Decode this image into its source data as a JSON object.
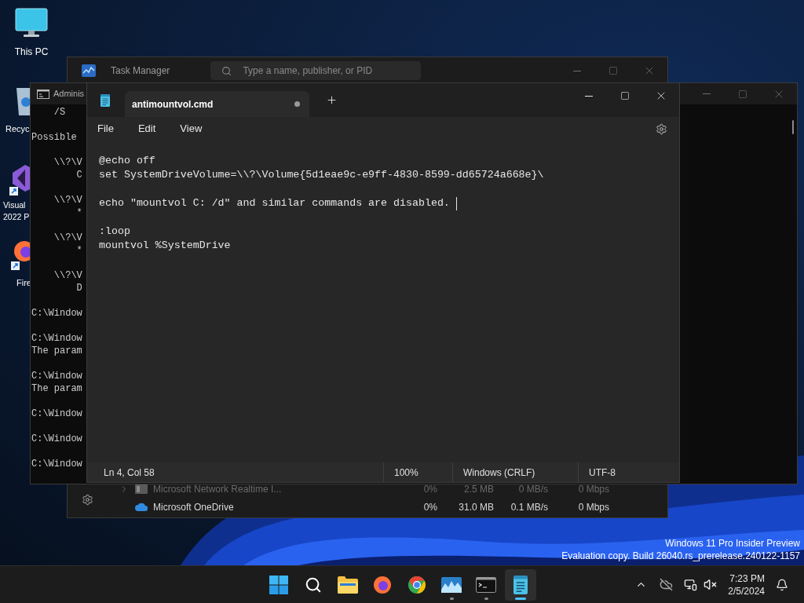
{
  "desktop": {
    "icons": [
      {
        "kind": "pc",
        "label_lines": [
          "This PC"
        ]
      },
      {
        "kind": "recycle",
        "label_lines": [
          "Recyc"
        ]
      },
      {
        "kind": "visual-studio",
        "label_lines": [
          "Visual",
          "2022 P"
        ]
      },
      {
        "kind": "firefox",
        "label_lines": [
          "Fire"
        ]
      }
    ]
  },
  "task_manager": {
    "title": "Task Manager",
    "search": {
      "placeholder": "Type a name, publisher, or PID"
    },
    "rows": [
      {
        "name": "Microsoft Network Realtime I...",
        "expandable": true,
        "dimmed": true,
        "values": [
          "0%",
          "2.5 MB",
          "0 MB/s",
          "0 Mbps"
        ]
      },
      {
        "name": "Microsoft OneDrive",
        "expandable": false,
        "dimmed": false,
        "values": [
          "0%",
          "31.0 MB",
          "0.1 MB/s",
          "0 Mbps"
        ]
      }
    ]
  },
  "console": {
    "title": "Adminis",
    "blocks": [
      [
        "    /S"
      ],
      [
        "Possible"
      ],
      [
        "    \\\\?\\V",
        "        C"
      ],
      [
        "    \\\\?\\V",
        "        *"
      ],
      [
        "    \\\\?\\V",
        "        *"
      ],
      [
        "    \\\\?\\V",
        "        D"
      ],
      [
        "C:\\Window"
      ],
      [
        "C:\\Window",
        "The param"
      ],
      [
        "C:\\Window",
        "The param"
      ],
      [
        "C:\\Window"
      ],
      [
        "C:\\Window"
      ],
      [
        "C:\\Window"
      ]
    ]
  },
  "notepad": {
    "tabs": [
      {
        "title": "antimountvol.cmd",
        "unsaved": true,
        "selected": true
      }
    ],
    "menu": [
      "File",
      "Edit",
      "View"
    ],
    "blocks": [
      [
        {
          "text": "@echo off",
          "caret": false
        },
        {
          "text": "set SystemDriveVolume=\\\\?\\Volume{5d1eae9c-e9ff-4830-8599-dd65724a668e}\\",
          "caret": false
        }
      ],
      [
        {
          "text": "echo \"mountvol C: /d\" and similar commands are disabled. ",
          "caret": true
        }
      ],
      [
        {
          "text": ":loop",
          "caret": false
        },
        {
          "text": "mountvol %SystemDrive",
          "caret": false
        }
      ]
    ],
    "status_bar": [
      "Ln 4, Col 58",
      "100%",
      "Windows (CRLF)",
      "UTF-8"
    ]
  },
  "build_info": [
    "Windows 11 Pro Insider Preview",
    "Evaluation copy. Build 26040.rs_prerelease.240122-1157"
  ],
  "taskbar": {
    "apps": [
      {
        "kind": "start",
        "running": false,
        "selected": false
      },
      {
        "kind": "search",
        "running": false,
        "selected": false
      },
      {
        "kind": "folder",
        "running": false,
        "selected": false
      },
      {
        "kind": "firefox",
        "running": false,
        "selected": false
      },
      {
        "kind": "chrome",
        "running": false,
        "selected": false
      },
      {
        "kind": "monitor",
        "running": true,
        "selected": false
      },
      {
        "kind": "terminal",
        "running": true,
        "selected": false
      },
      {
        "kind": "notepad",
        "running": true,
        "selected": true
      }
    ],
    "clock": {
      "time": "7:23 PM",
      "date": "2/5/2024"
    }
  }
}
